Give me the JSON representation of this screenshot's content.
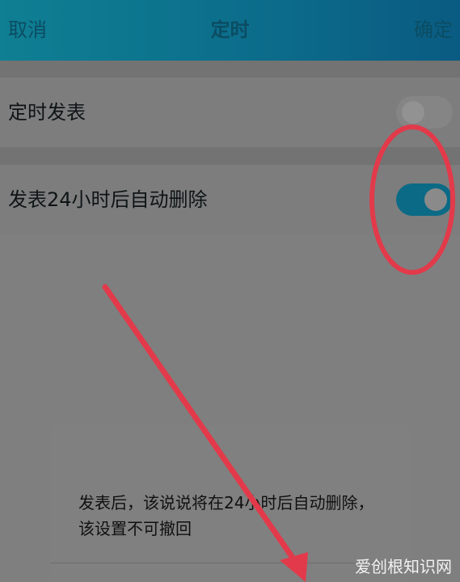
{
  "header": {
    "cancel": "取消",
    "title": "定时",
    "confirm": "确定"
  },
  "settings": [
    {
      "label": "定时发表",
      "enabled": false
    },
    {
      "label": "发表24小时后自动删除",
      "enabled": true
    }
  ],
  "dialog": {
    "message": "发表后，该说说将在24小时后自动删除，该设置不可撤回"
  },
  "watermark": "爱创根知识网",
  "annotation_color": "#e23a4a"
}
